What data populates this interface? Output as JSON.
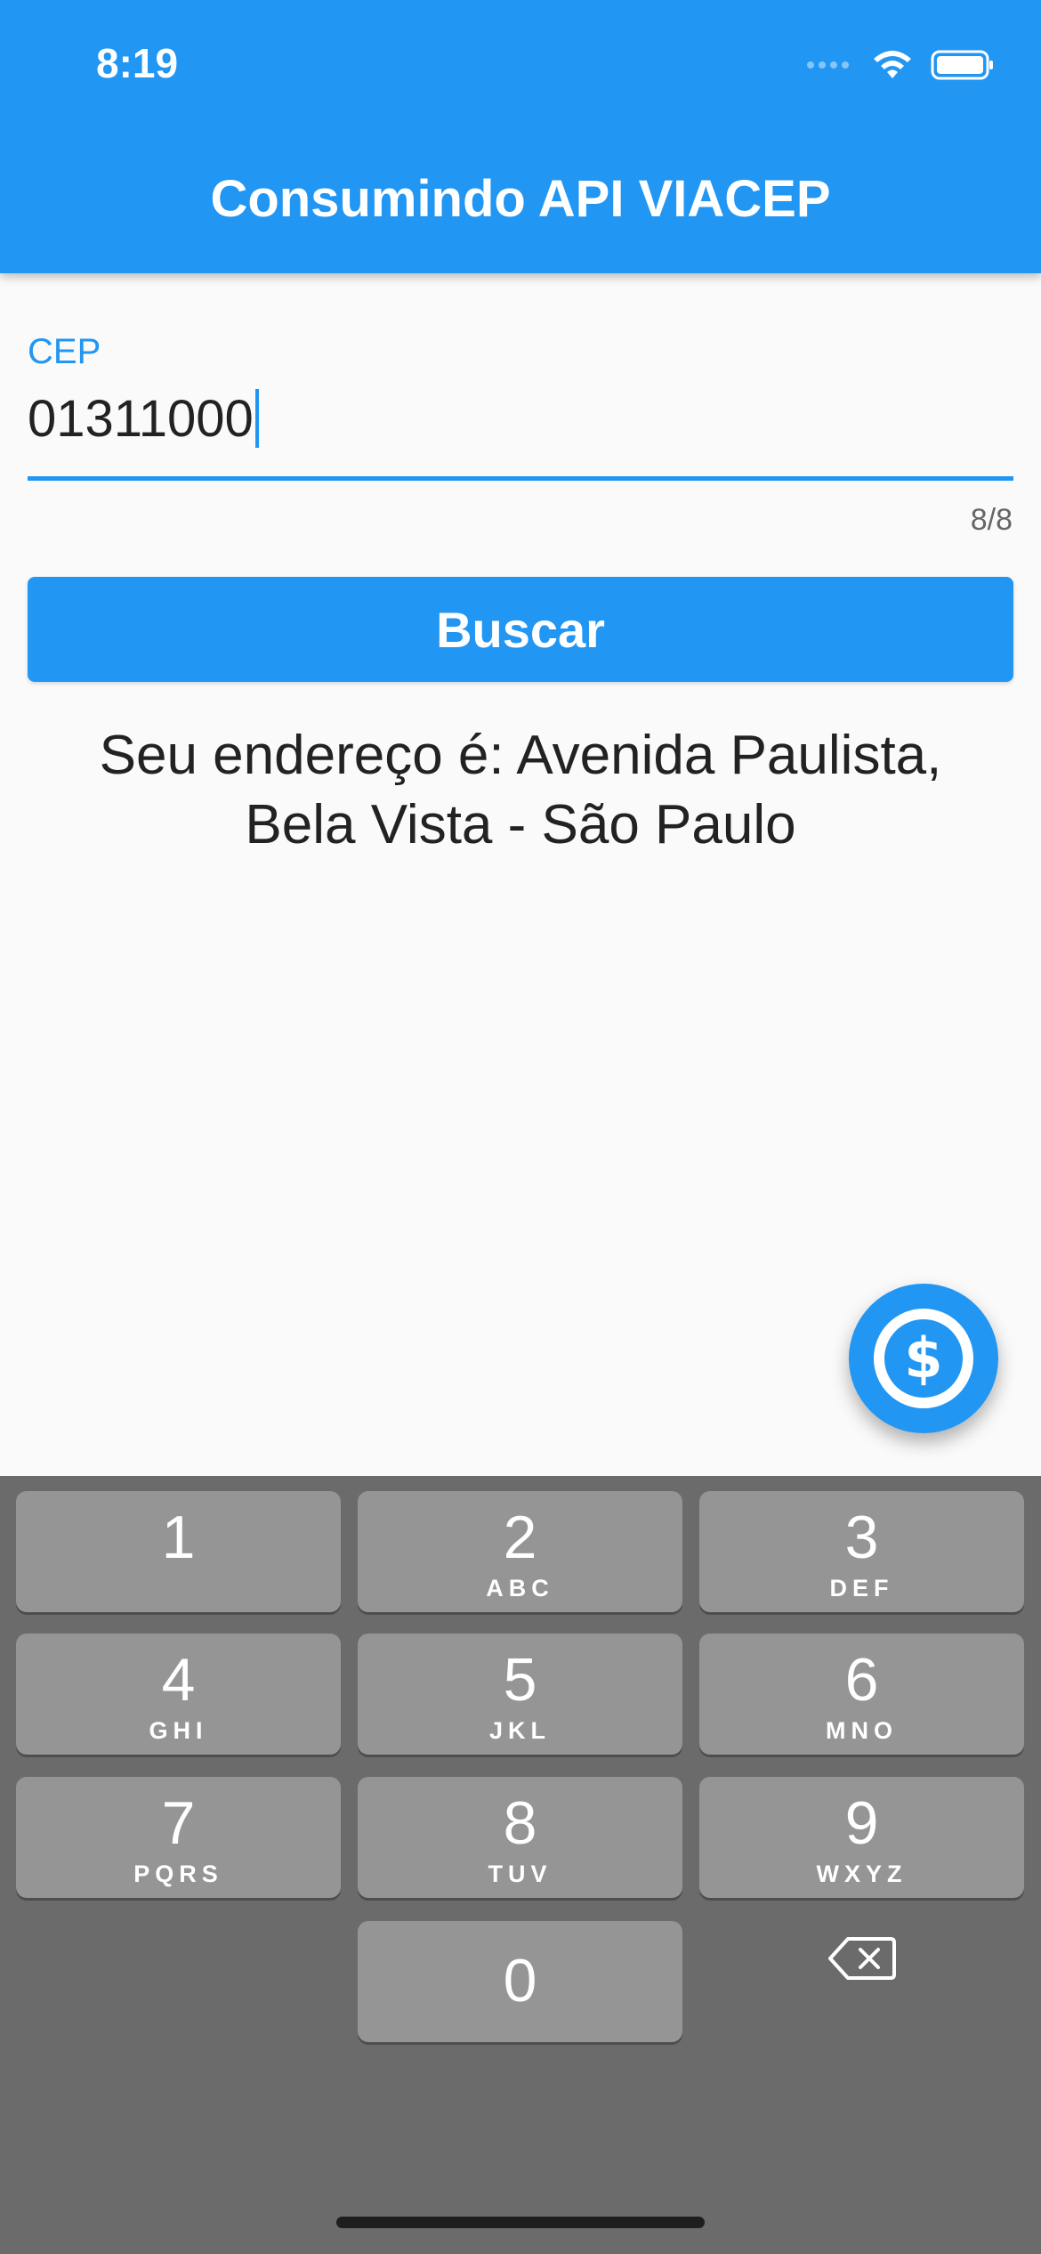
{
  "status_bar": {
    "time": "8:19"
  },
  "app_bar": {
    "title": "Consumindo API VIACEP",
    "color": "#2196f3"
  },
  "cep_field": {
    "label": "CEP",
    "value": "01311000",
    "counter": "8/8"
  },
  "search_button": {
    "label": "Buscar"
  },
  "result": {
    "line1": "Seu endereço é: Avenida Paulista,",
    "line2": "Bela Vista - São Paulo"
  },
  "fab": {
    "icon": "dollar-icon"
  },
  "keyboard": {
    "keys": [
      {
        "num": "1",
        "letters": ""
      },
      {
        "num": "2",
        "letters": "ABC"
      },
      {
        "num": "3",
        "letters": "DEF"
      },
      {
        "num": "4",
        "letters": "GHI"
      },
      {
        "num": "5",
        "letters": "JKL"
      },
      {
        "num": "6",
        "letters": "MNO"
      },
      {
        "num": "7",
        "letters": "PQRS"
      },
      {
        "num": "8",
        "letters": "TUV"
      },
      {
        "num": "9",
        "letters": "WXYZ"
      },
      {
        "num": "0",
        "letters": ""
      }
    ],
    "backspace_icon": "backspace-icon"
  }
}
